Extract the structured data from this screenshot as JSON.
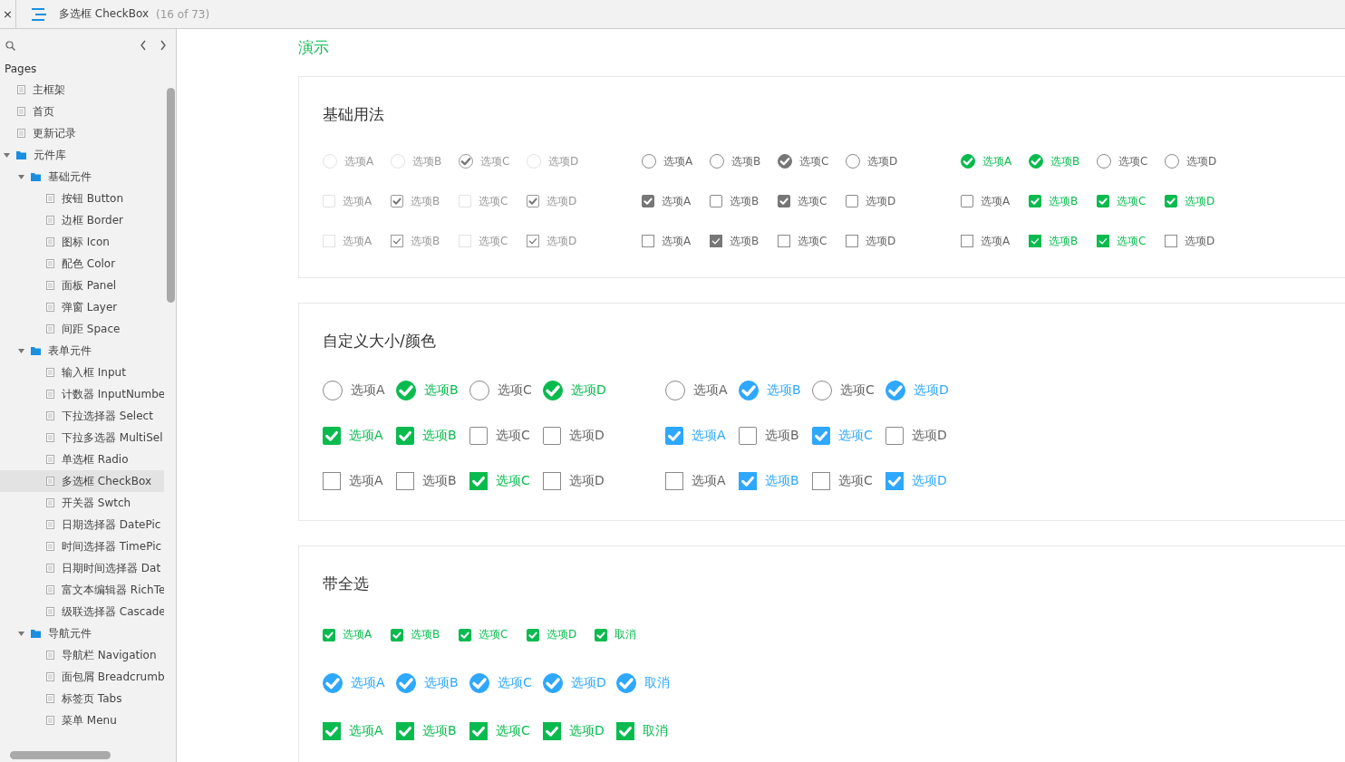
{
  "topbar": {
    "close": "×",
    "title": "多选框 CheckBox",
    "count": "(16 of 73)"
  },
  "sidebar": {
    "heading": "Pages",
    "tree": [
      {
        "label": "主框架",
        "kind": "page",
        "selected": false
      },
      {
        "label": "首页",
        "kind": "page",
        "selected": false
      },
      {
        "label": "更新记录",
        "kind": "page",
        "selected": false
      },
      {
        "label": "元件库",
        "kind": "folder",
        "expanded": true,
        "selected": false,
        "children": [
          {
            "label": "基础元件",
            "kind": "folder",
            "expanded": true,
            "selected": false,
            "children": [
              {
                "label": "按钮 Button",
                "kind": "page",
                "selected": false
              },
              {
                "label": "边框 Border",
                "kind": "page",
                "selected": false
              },
              {
                "label": "图标 Icon",
                "kind": "page",
                "selected": false
              },
              {
                "label": "配色 Color",
                "kind": "page",
                "selected": false
              },
              {
                "label": "面板 Panel",
                "kind": "page",
                "selected": false
              },
              {
                "label": "弹窗 Layer",
                "kind": "page",
                "selected": false
              },
              {
                "label": "间距 Space",
                "kind": "page",
                "selected": false
              }
            ]
          },
          {
            "label": "表单元件",
            "kind": "folder",
            "expanded": true,
            "selected": false,
            "children": [
              {
                "label": "输入框 Input",
                "kind": "page",
                "selected": false
              },
              {
                "label": "计数器 InputNumbe",
                "kind": "page",
                "selected": false
              },
              {
                "label": "下拉选择器 Select",
                "kind": "page",
                "selected": false
              },
              {
                "label": "下拉多选器 MultiSel",
                "kind": "page",
                "selected": false
              },
              {
                "label": "单选框 Radio",
                "kind": "page",
                "selected": false
              },
              {
                "label": "多选框 CheckBox",
                "kind": "page",
                "selected": true
              },
              {
                "label": "开关器 Swtch",
                "kind": "page",
                "selected": false
              },
              {
                "label": "日期选择器 DatePic",
                "kind": "page",
                "selected": false
              },
              {
                "label": "时间选择器 TimePic",
                "kind": "page",
                "selected": false
              },
              {
                "label": "日期时间选择器 Dat",
                "kind": "page",
                "selected": false
              },
              {
                "label": "富文本编辑器 RichTe",
                "kind": "page",
                "selected": false
              },
              {
                "label": "级联选择器 Cascade",
                "kind": "page",
                "selected": false
              }
            ]
          },
          {
            "label": "导航元件",
            "kind": "folder",
            "expanded": true,
            "selected": false,
            "children": [
              {
                "label": "导航栏 Navigation",
                "kind": "page",
                "selected": false
              },
              {
                "label": "面包屑 Breadcrumb",
                "kind": "page",
                "selected": false
              },
              {
                "label": "标签页 Tabs",
                "kind": "page",
                "selected": false
              },
              {
                "label": "菜单 Menu",
                "kind": "page",
                "selected": false
              }
            ]
          }
        ]
      }
    ]
  },
  "heading": "演示",
  "sections": [
    {
      "title": "基础用法",
      "rows": [
        {
          "groups": [
            {
              "kind": "round",
              "color": "#9a9a9a",
              "disabled": true,
              "items": [
                {
                  "label": "选项A",
                  "checked": false
                },
                {
                  "label": "选项B",
                  "checked": false
                },
                {
                  "label": "选项C",
                  "checked": true
                },
                {
                  "label": "选项D",
                  "checked": false
                }
              ]
            },
            {
              "kind": "round",
              "color": "#777777",
              "disabled": false,
              "items": [
                {
                  "label": "选项A",
                  "checked": false
                },
                {
                  "label": "选项B",
                  "checked": false
                },
                {
                  "label": "选项C",
                  "checked": true
                },
                {
                  "label": "选项D",
                  "checked": false
                }
              ]
            },
            {
              "kind": "round",
              "color": "#09bb4f",
              "disabled": false,
              "items": [
                {
                  "label": "选项A",
                  "checked": true
                },
                {
                  "label": "选项B",
                  "checked": true
                },
                {
                  "label": "选项C",
                  "checked": false
                },
                {
                  "label": "选项D",
                  "checked": false
                }
              ]
            }
          ]
        },
        {
          "groups": [
            {
              "kind": "square",
              "color": "#9a9a9a",
              "disabled": true,
              "items": [
                {
                  "label": "选项A",
                  "checked": false
                },
                {
                  "label": "选项B",
                  "checked": true
                },
                {
                  "label": "选项C",
                  "checked": false
                },
                {
                  "label": "选项D",
                  "checked": true
                }
              ]
            },
            {
              "kind": "square",
              "color": "#777777",
              "disabled": false,
              "items": [
                {
                  "label": "选项A",
                  "checked": true
                },
                {
                  "label": "选项B",
                  "checked": false
                },
                {
                  "label": "选项C",
                  "checked": true
                },
                {
                  "label": "选项D",
                  "checked": false
                }
              ]
            },
            {
              "kind": "square",
              "color": "#09bb4f",
              "disabled": false,
              "items": [
                {
                  "label": "选项A",
                  "checked": false
                },
                {
                  "label": "选项B",
                  "checked": true
                },
                {
                  "label": "选项C",
                  "checked": true
                },
                {
                  "label": "选项D",
                  "checked": true
                }
              ]
            }
          ]
        },
        {
          "groups": [
            {
              "kind": "sharp",
              "color": "#9a9a9a",
              "disabled": true,
              "items": [
                {
                  "label": "选项A",
                  "checked": false
                },
                {
                  "label": "选项B",
                  "checked": true
                },
                {
                  "label": "选项C",
                  "checked": false
                },
                {
                  "label": "选项D",
                  "checked": true
                }
              ]
            },
            {
              "kind": "sharp",
              "color": "#777777",
              "disabled": false,
              "items": [
                {
                  "label": "选项A",
                  "checked": false
                },
                {
                  "label": "选项B",
                  "checked": true
                },
                {
                  "label": "选项C",
                  "checked": false
                },
                {
                  "label": "选项D",
                  "checked": false
                }
              ]
            },
            {
              "kind": "sharp",
              "color": "#09bb4f",
              "disabled": false,
              "items": [
                {
                  "label": "选项A",
                  "checked": false
                },
                {
                  "label": "选项B",
                  "checked": true
                },
                {
                  "label": "选项C",
                  "checked": true
                },
                {
                  "label": "选项D",
                  "checked": false
                }
              ]
            }
          ]
        }
      ]
    },
    {
      "title": "自定义大小/颜色",
      "rows": [
        {
          "groups": [
            {
              "kind": "bigRound",
              "color": "#09bb4f",
              "disabled": false,
              "items": [
                {
                  "label": "选项A",
                  "checked": false
                },
                {
                  "label": "选项B",
                  "checked": true
                },
                {
                  "label": "选项C",
                  "checked": false
                },
                {
                  "label": "选项D",
                  "checked": true
                }
              ]
            },
            {
              "kind": "bigRound",
              "color": "#2ea7ff",
              "disabled": false,
              "items": [
                {
                  "label": "选项A",
                  "checked": false
                },
                {
                  "label": "选项B",
                  "checked": true
                },
                {
                  "label": "选项C",
                  "checked": false
                },
                {
                  "label": "选项D",
                  "checked": true
                }
              ]
            }
          ]
        },
        {
          "groups": [
            {
              "kind": "bigSquare",
              "color": "#09bb4f",
              "disabled": false,
              "items": [
                {
                  "label": "选项A",
                  "checked": true
                },
                {
                  "label": "选项B",
                  "checked": true
                },
                {
                  "label": "选项C",
                  "checked": false
                },
                {
                  "label": "选项D",
                  "checked": false
                }
              ]
            },
            {
              "kind": "bigSquare",
              "color": "#2ea7ff",
              "disabled": false,
              "items": [
                {
                  "label": "选项A",
                  "checked": true
                },
                {
                  "label": "选项B",
                  "checked": false
                },
                {
                  "label": "选项C",
                  "checked": true
                },
                {
                  "label": "选项D",
                  "checked": false
                }
              ]
            }
          ]
        },
        {
          "groups": [
            {
              "kind": "bigSharp",
              "color": "#09bb4f",
              "disabled": false,
              "items": [
                {
                  "label": "选项A",
                  "checked": false
                },
                {
                  "label": "选项B",
                  "checked": false
                },
                {
                  "label": "选项C",
                  "checked": true
                },
                {
                  "label": "选项D",
                  "checked": false
                }
              ]
            },
            {
              "kind": "bigSharp",
              "color": "#2ea7ff",
              "disabled": false,
              "items": [
                {
                  "label": "选项A",
                  "checked": false
                },
                {
                  "label": "选项B",
                  "checked": true
                },
                {
                  "label": "选项C",
                  "checked": false
                },
                {
                  "label": "选项D",
                  "checked": true
                }
              ]
            }
          ]
        }
      ]
    },
    {
      "title": "带全选",
      "rows": [
        {
          "groups": [
            {
              "kind": "square",
              "color": "#09bb4f",
              "disabled": false,
              "items": [
                {
                  "label": "选项A",
                  "checked": true
                },
                {
                  "label": "选项B",
                  "checked": true
                },
                {
                  "label": "选项C",
                  "checked": true
                },
                {
                  "label": "选项D",
                  "checked": true
                },
                {
                  "label": "取消",
                  "checked": true
                }
              ]
            }
          ]
        },
        {
          "groups": [
            {
              "kind": "bigRound",
              "color": "#2ea7ff",
              "disabled": false,
              "items": [
                {
                  "label": "选项A",
                  "checked": true
                },
                {
                  "label": "选项B",
                  "checked": true
                },
                {
                  "label": "选项C",
                  "checked": true
                },
                {
                  "label": "选项D",
                  "checked": true
                },
                {
                  "label": "取消",
                  "checked": true
                }
              ]
            }
          ]
        },
        {
          "groups": [
            {
              "kind": "bigSharp",
              "color": "#09bb4f",
              "disabled": false,
              "items": [
                {
                  "label": "选项A",
                  "checked": true
                },
                {
                  "label": "选项B",
                  "checked": true
                },
                {
                  "label": "选项C",
                  "checked": true
                },
                {
                  "label": "选项D",
                  "checked": true
                },
                {
                  "label": "取消",
                  "checked": true
                }
              ]
            }
          ]
        }
      ]
    }
  ]
}
